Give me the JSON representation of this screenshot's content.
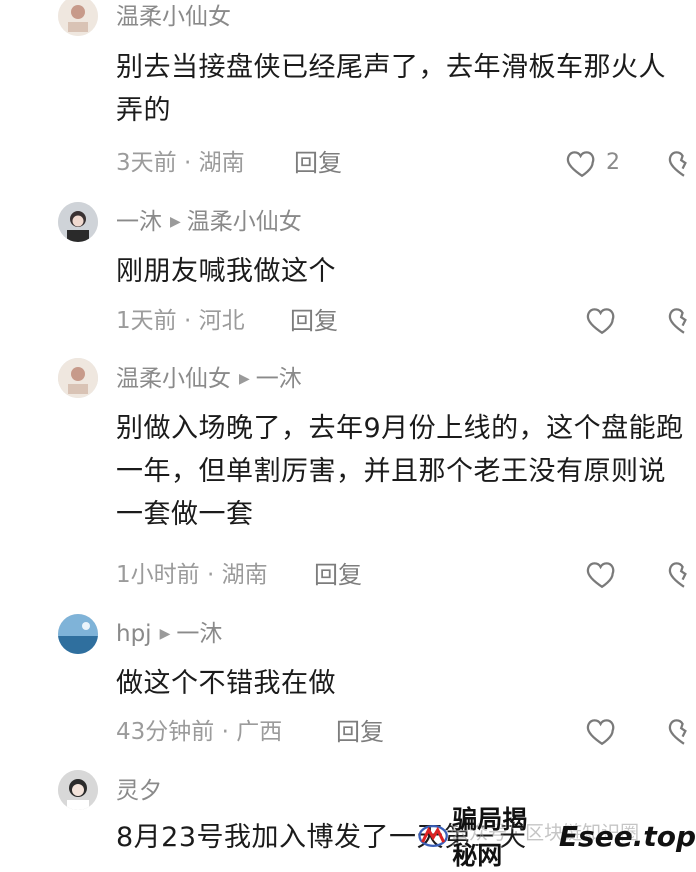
{
  "comments": [
    {
      "author": "温柔小仙女",
      "reply_to": "",
      "text": "别去当接盘侠已经尾声了，去年滑板车那火人弄的",
      "info": "3天前 · 湖南",
      "reply_label": "回复",
      "likes": "2"
    },
    {
      "author": "一沐",
      "reply_to": "温柔小仙女",
      "text": "刚朋友喊我做这个",
      "info": "1天前 · 河北",
      "reply_label": "回复",
      "likes": ""
    },
    {
      "author": "温柔小仙女",
      "reply_to": "一沐",
      "text": "别做入场晚了，去年9月份上线的，这个盘能跑一年，但单割厉害，并且那个老王没有原则说一套做一套",
      "info": "1小时前 · 湖南",
      "reply_label": "回复",
      "likes": ""
    },
    {
      "author": "hpj",
      "reply_to": "一沐",
      "text": "做这个不错我在做",
      "info": "43分钟前 · 广西",
      "reply_label": "回复",
      "likes": ""
    },
    {
      "author": "灵夕",
      "reply_to": "",
      "text": "8月23号我加入博发了一天第三天",
      "info": "",
      "reply_label": "",
      "likes": ""
    }
  ],
  "watermark": {
    "faded_text": "公众号 · 区块链知识圈",
    "brand": "骗局揭秘网",
    "site": "Esee.top"
  },
  "colors": {
    "text": "#1b1b1b",
    "meta": "#8a8a8a",
    "icon": "#7a7a7a"
  }
}
